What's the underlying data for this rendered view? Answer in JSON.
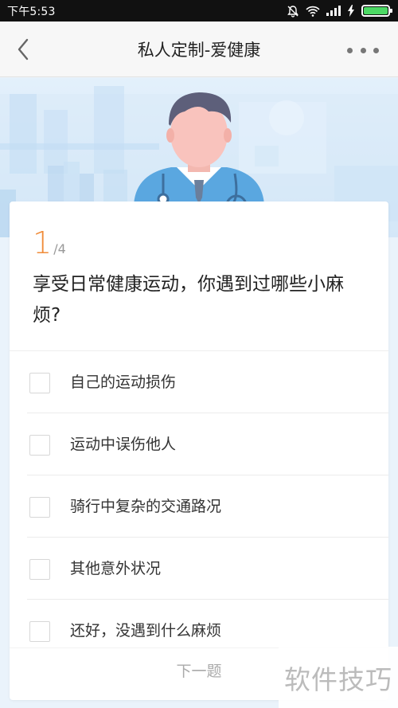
{
  "status_bar": {
    "time": "下午5:53",
    "icons": [
      "bell-mute-icon",
      "wifi-icon",
      "signal-icon",
      "charging-icon",
      "battery-icon"
    ],
    "battery_color": "#4cd964"
  },
  "header": {
    "title": "私人定制-爱健康",
    "back_icon": "chevron-left-icon",
    "more_icon": "more-dots-icon"
  },
  "question": {
    "current": "1",
    "total": "/4",
    "text": "享受日常健康运动，你遇到过哪些小麻烦?",
    "accent_color": "#f08c3a"
  },
  "options": [
    {
      "label": "自己的运动损伤"
    },
    {
      "label": "运动中误伤他人"
    },
    {
      "label": "骑行中复杂的交通路况"
    },
    {
      "label": "其他意外状况"
    },
    {
      "label": "还好，没遇到什么麻烦"
    }
  ],
  "footer": {
    "next_label": "下一题"
  },
  "watermark": "软件技巧"
}
